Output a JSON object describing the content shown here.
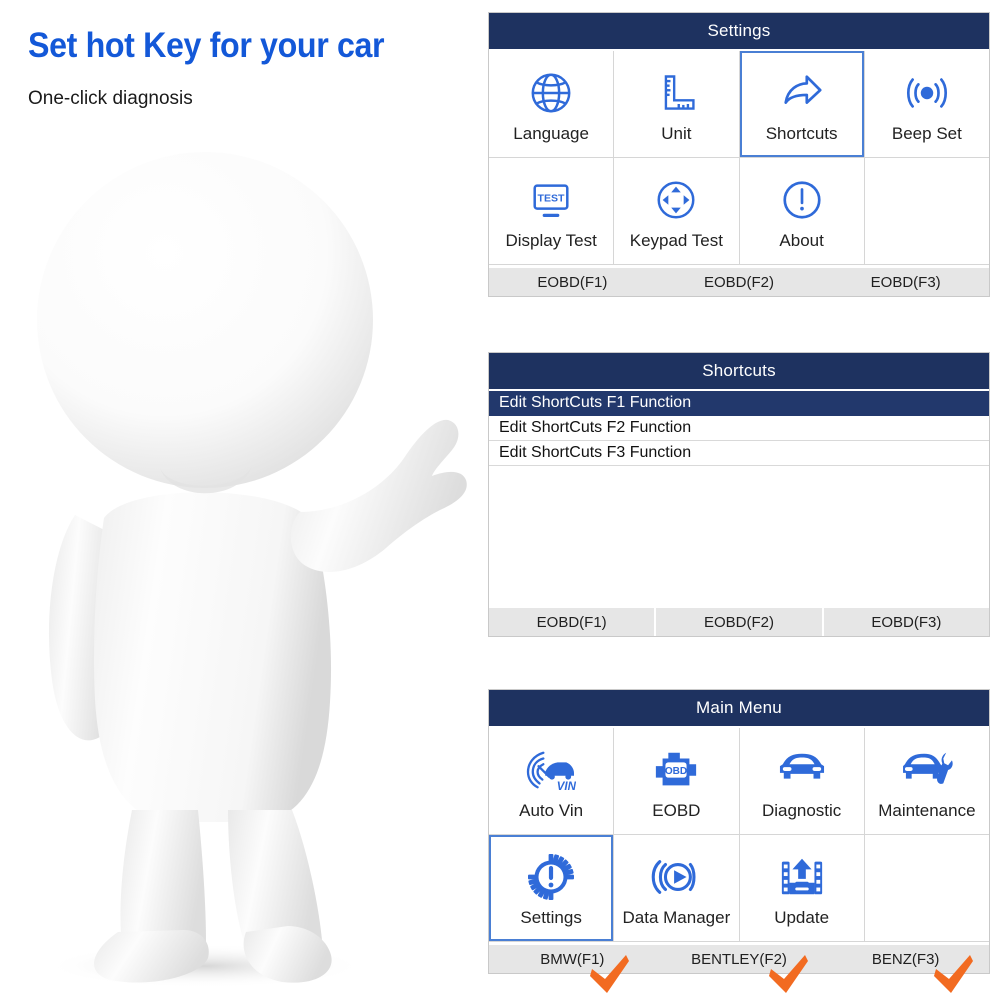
{
  "promo": {
    "title": "Set hot Key for your car",
    "subtitle": "One-click diagnosis",
    "title_color": "#1358d8"
  },
  "colors": {
    "header_navy": "#1e3260",
    "icon_blue": "#2f6ad9",
    "selection_navy": "#22386c",
    "selected_tile_border": "#4a7fd4",
    "softkey_bg": "#e6e6e6",
    "check_orange": "#f26b21"
  },
  "panels": [
    {
      "id": "settings",
      "title": "Settings",
      "tiles": [
        {
          "label": "Language",
          "icon": "globe-icon",
          "selected": false
        },
        {
          "label": "Unit",
          "icon": "ruler-icon",
          "selected": false
        },
        {
          "label": "Shortcuts",
          "icon": "share-arrow-icon",
          "selected": true
        },
        {
          "label": "Beep Set",
          "icon": "beep-icon",
          "selected": false
        },
        {
          "label": "Display Test",
          "icon": "monitor-test-icon",
          "selected": false
        },
        {
          "label": "Keypad Test",
          "icon": "dpad-circle-icon",
          "selected": false
        },
        {
          "label": "About",
          "icon": "info-circle-icon",
          "selected": false
        },
        {
          "label": "",
          "icon": "none",
          "selected": false
        }
      ],
      "softkeys": [
        "EOBD(F1)",
        "EOBD(F2)",
        "EOBD(F3)"
      ],
      "softkeys_divided": false
    },
    {
      "id": "shortcuts",
      "title": "Shortcuts",
      "rows": [
        {
          "label": "Edit ShortCuts F1 Function",
          "selected": true
        },
        {
          "label": "Edit ShortCuts F2 Function",
          "selected": false
        },
        {
          "label": "Edit ShortCuts F3 Function",
          "selected": false
        }
      ],
      "softkeys": [
        "EOBD(F1)",
        "EOBD(F2)",
        "EOBD(F3)"
      ],
      "softkeys_divided": true
    },
    {
      "id": "mainmenu",
      "title": "Main Menu",
      "tiles": [
        {
          "label": "Auto Vin",
          "icon": "auto-vin-icon",
          "selected": false
        },
        {
          "label": "EOBD",
          "icon": "obd-engine-icon",
          "selected": false
        },
        {
          "label": "Diagnostic",
          "icon": "car-front-icon",
          "selected": false
        },
        {
          "label": "Maintenance",
          "icon": "car-wrench-icon",
          "selected": false
        },
        {
          "label": "Settings",
          "icon": "gear-alert-icon",
          "selected": true
        },
        {
          "label": "Data Manager",
          "icon": "play-circle-icon",
          "selected": false
        },
        {
          "label": "Update",
          "icon": "upload-film-icon",
          "selected": false
        },
        {
          "label": "",
          "icon": "none",
          "selected": false
        }
      ],
      "softkeys": [
        "BMW(F1)",
        "BENTLEY(F2)",
        "BENZ(F3)"
      ],
      "softkeys_divided": false
    }
  ],
  "annotations": {
    "checks": [
      "check-mark-1",
      "check-mark-2",
      "check-mark-3"
    ]
  }
}
